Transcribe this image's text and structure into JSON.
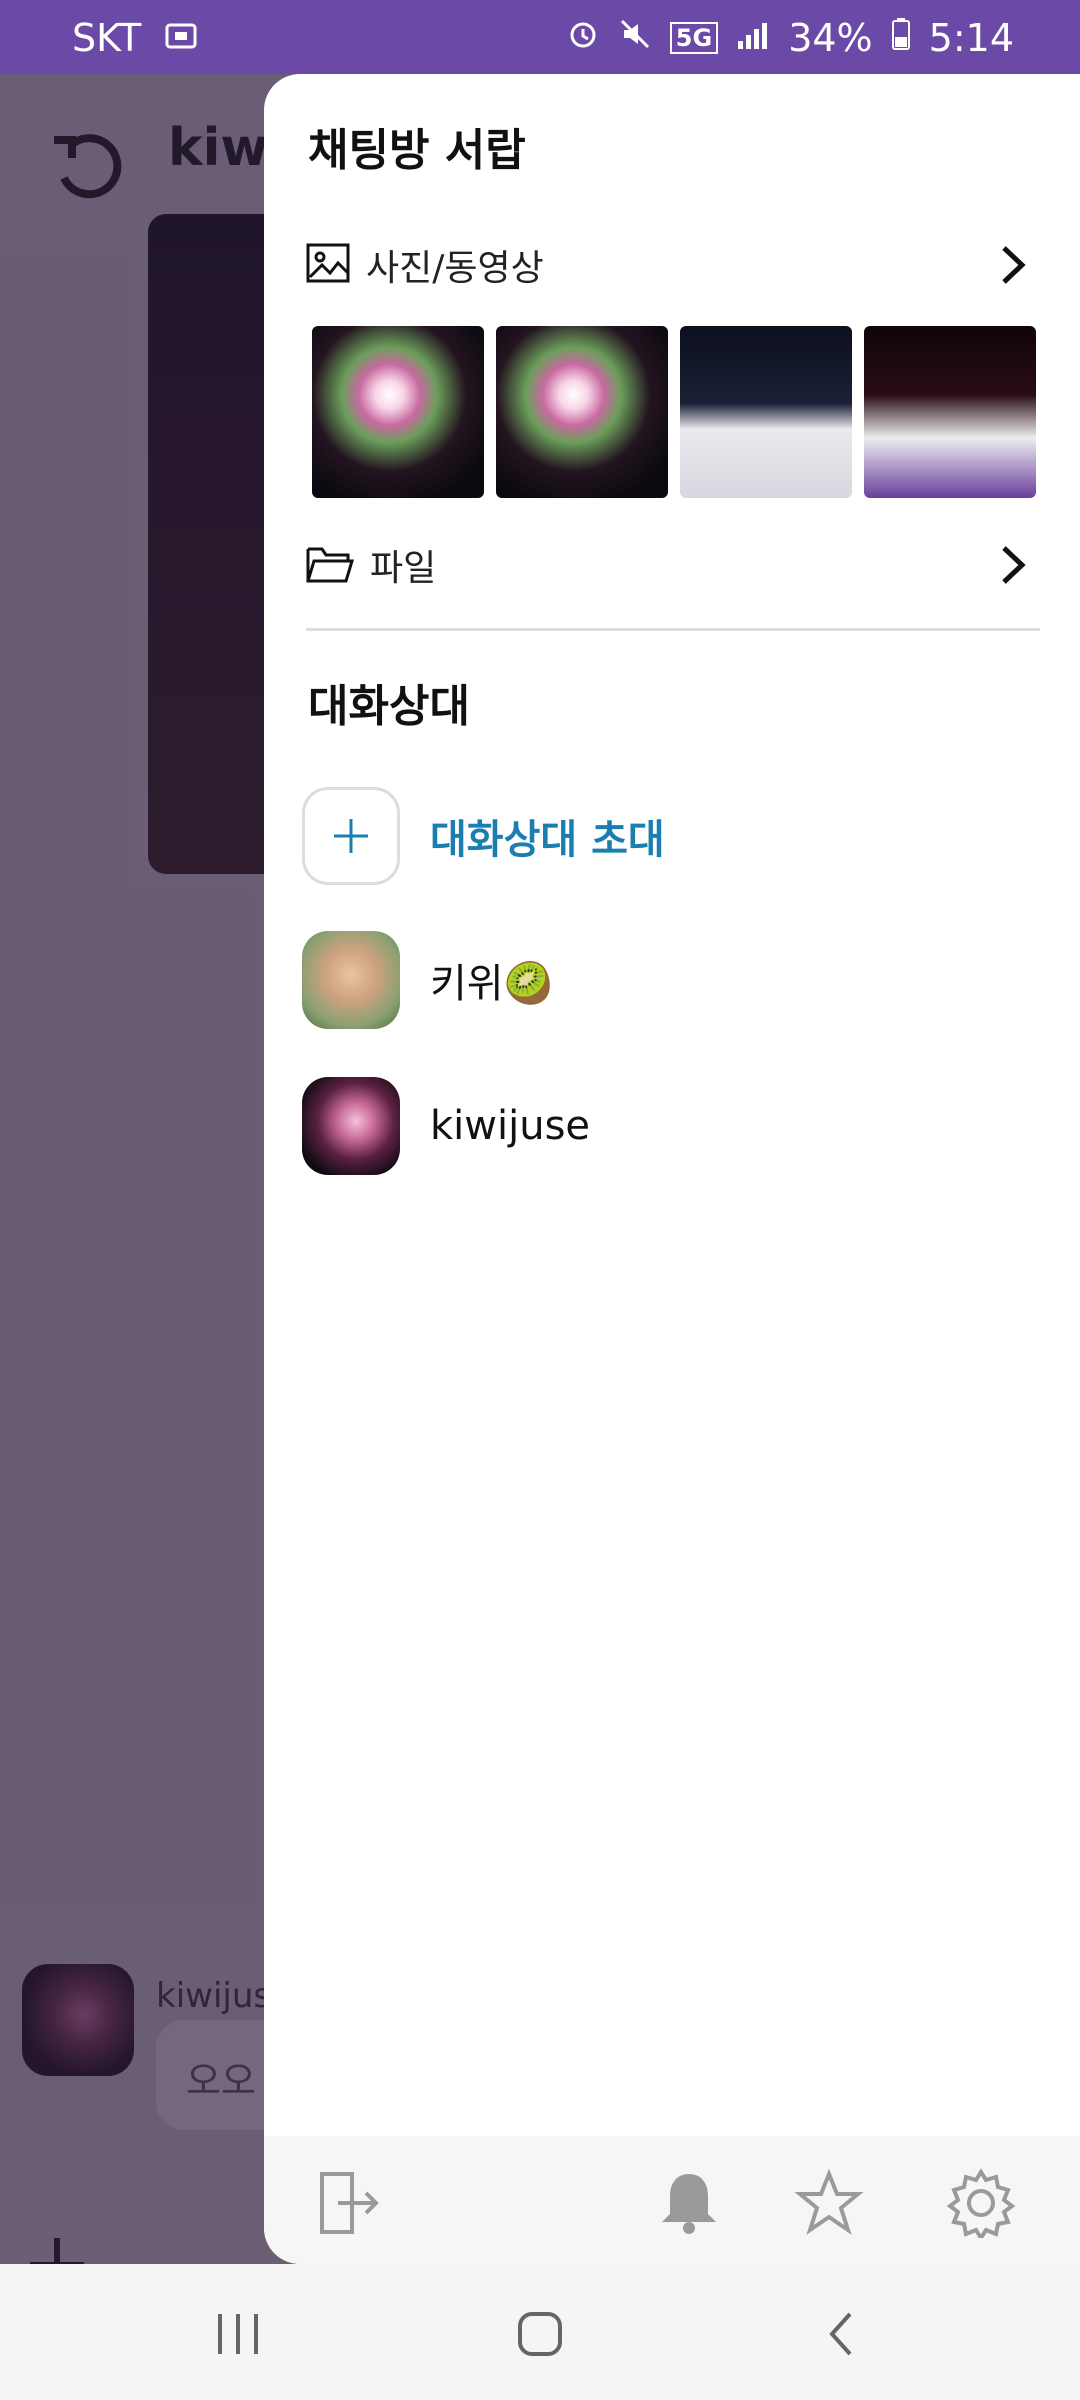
{
  "status_bar": {
    "carrier": "SKT",
    "network": "5G",
    "battery": "34%",
    "time": "5:14"
  },
  "chat": {
    "title": "kiwi",
    "sender_name": "kiwijuse",
    "bubble_text": "오오"
  },
  "drawer": {
    "title": "채팅방 서랍",
    "media_label": "사진/동영상",
    "files_label": "파일",
    "participants_title": "대화상대",
    "participants": [
      {
        "name": "대화상대 초대",
        "type": "invite"
      },
      {
        "name": "키위🥝",
        "type": "user"
      },
      {
        "name": "kiwijuse",
        "type": "user"
      }
    ]
  },
  "icons": {
    "back": "undo-icon",
    "media": "image-icon",
    "files": "folder-icon",
    "chevron": "chevron-right-icon",
    "leave": "exit-icon",
    "notification": "bell-icon",
    "favorite": "star-icon",
    "settings": "gear-icon"
  },
  "colors": {
    "status_bar": "#6a4aa6",
    "invite_accent": "#1a7fb0",
    "overlay": "#5a4a68"
  }
}
